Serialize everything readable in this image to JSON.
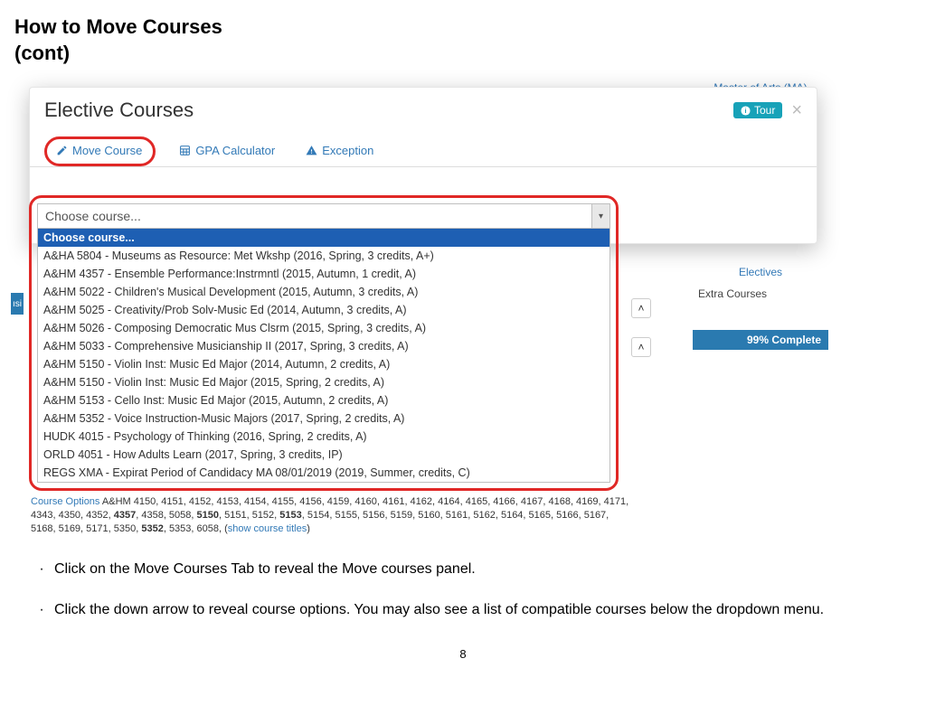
{
  "doc": {
    "title_line1": "How to Move Courses",
    "title_line2": "(cont)",
    "page_number": "8",
    "bullet1": "Click on the Move Courses Tab to reveal the Move courses panel.",
    "bullet2": "Click the down arrow to reveal course options. You may also see a list of compatible courses below the dropdown menu."
  },
  "sidebar": {
    "degree": "Master of Arts (MA)",
    "electives_label": "Electives",
    "extra_courses_label": "Extra Courses",
    "progress": "99% Complete",
    "move_button": "Move Course"
  },
  "modal": {
    "title": "Elective Courses",
    "tour_label": "Tour",
    "tabs": {
      "move": "Move Course",
      "gpa": "GPA Calculator",
      "exception": "Exception"
    }
  },
  "dropdown": {
    "placeholder": "Choose course...",
    "options": [
      "Choose course...",
      "A&HA 5804 - Museums as Resource: Met Wkshp (2016, Spring, 3 credits, A+)",
      "A&HM 4357 - Ensemble Performance:Instrmntl (2015, Autumn, 1 credit, A)",
      "A&HM 5022 - Children's Musical Development (2015, Autumn, 3 credits, A)",
      "A&HM 5025 - Creativity/Prob Solv-Music Ed (2014, Autumn, 3 credits, A)",
      "A&HM 5026 - Composing Democratic Mus Clsrm (2015, Spring, 3 credits, A)",
      "A&HM 5033 - Comprehensive Musicianship II (2017, Spring, 3 credits, A)",
      "A&HM 5150 - Violin Inst: Music Ed Major (2014, Autumn, 2 credits, A)",
      "A&HM 5150 - Violin Inst: Music Ed Major (2015, Spring, 2 credits, A)",
      "A&HM 5153 - Cello Inst: Music Ed Major (2015, Autumn, 2 credits, A)",
      "A&HM 5352 - Voice Instruction-Music Majors (2017, Spring, 2 credits, A)",
      "HUDK 4015 - Psychology of Thinking (2016, Spring, 2 credits, A)",
      "ORLD 4051 - How Adults Learn (2017, Spring, 3 credits, IP)",
      "REGS XMA - Expirat Period of Candidacy MA 08/01/2019 (2019, Summer, credits, C)"
    ]
  },
  "course_options": {
    "label": "Course Options",
    "prefix": "A&HM 4150, 4151, 4152, 4153, 4154, 4155, 4156, 4159, 4160, 4161, 4162, 4164, 4165, 4166, 4167, 4168, 4169, 4171, 4343, 4350, 4352, ",
    "b1": "4357",
    "mid1": ", 4358, 5058, ",
    "b2": "5150",
    "mid2": ", 5151, 5152, ",
    "b3": "5153",
    "mid3": ", 5154, 5155, 5156, 5159, 5160, 5161, 5162, 5164, 5165, 5166, 5167, 5168, 5169, 5171, 5350, ",
    "b4": "5352",
    "suffix": ", 5353, 6058, (",
    "link": "show course titles",
    "close": ")"
  }
}
